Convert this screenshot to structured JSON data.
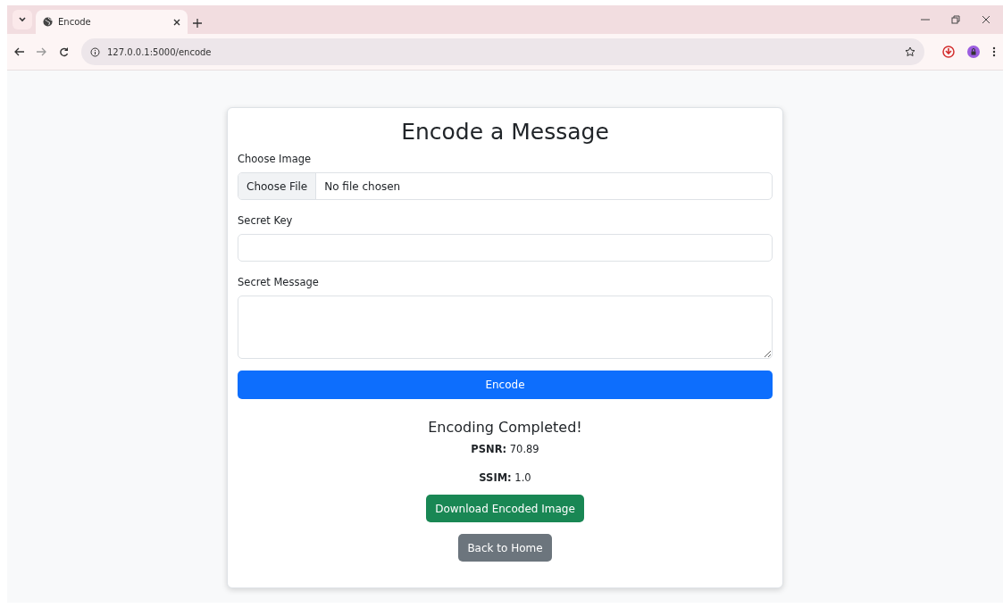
{
  "browser": {
    "tabs": [
      {
        "title": "Encode",
        "selected": true
      }
    ],
    "url": "127.0.0.1:5000/encode"
  },
  "form": {
    "title": "Encode a Message",
    "fields": [
      {
        "kind": "file",
        "label": "Choose Image",
        "button": "Choose File",
        "value": "No file chosen"
      },
      {
        "kind": "text",
        "label": "Secret Key"
      },
      {
        "kind": "textarea",
        "label": "Secret Message"
      }
    ],
    "submit": "Encode"
  },
  "result": {
    "heading": "Encoding Completed!",
    "metrics": [
      "**PSNR:** 70.89",
      "**SSIM:** 1.0"
    ],
    "buttons": [
      {
        "label": "Download Encoded Image",
        "kind": "success"
      },
      {
        "label": "Back to Home",
        "kind": "secondary"
      }
    ]
  }
}
